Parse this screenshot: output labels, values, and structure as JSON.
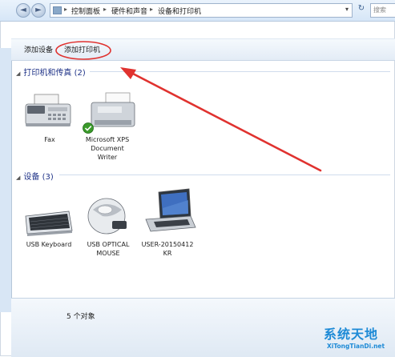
{
  "nav": {
    "back_glyph": "◄",
    "forward_glyph": "►"
  },
  "address": {
    "crumbs": [
      "控制面板",
      "硬件和声音",
      "设备和打印机"
    ],
    "separator": "▸",
    "dropdown_glyph": "▾"
  },
  "refresh_glyph": "↻",
  "search": {
    "placeholder": "搜索"
  },
  "toolbar": {
    "add_device": "添加设备",
    "add_printer": "添加打印机"
  },
  "groups": {
    "printers": {
      "title": "打印机和传真 (2)",
      "items": [
        {
          "label": "Fax",
          "icon": "fax-icon"
        },
        {
          "label": "Microsoft XPS Document Writer",
          "icon": "printer-icon",
          "default": true
        }
      ]
    },
    "devices": {
      "title": "设备 (3)",
      "items": [
        {
          "label": "USB Keyboard",
          "icon": "keyboard-icon"
        },
        {
          "label": "USB OPTICAL MOUSE",
          "icon": "mouse-icon"
        },
        {
          "label": "USER-20150412 KR",
          "icon": "laptop-icon"
        }
      ]
    }
  },
  "status": {
    "text": "5 个对象",
    "icon": "camera-printer-icon"
  },
  "watermark": {
    "title": "系统天地",
    "url": "XiTongTianDi.net",
    "icon": "logo-icon"
  },
  "annotation": {
    "color": "#e0322f"
  },
  "colors": {
    "accent": "#1e3287",
    "link_blue": "#1d8ad6"
  }
}
